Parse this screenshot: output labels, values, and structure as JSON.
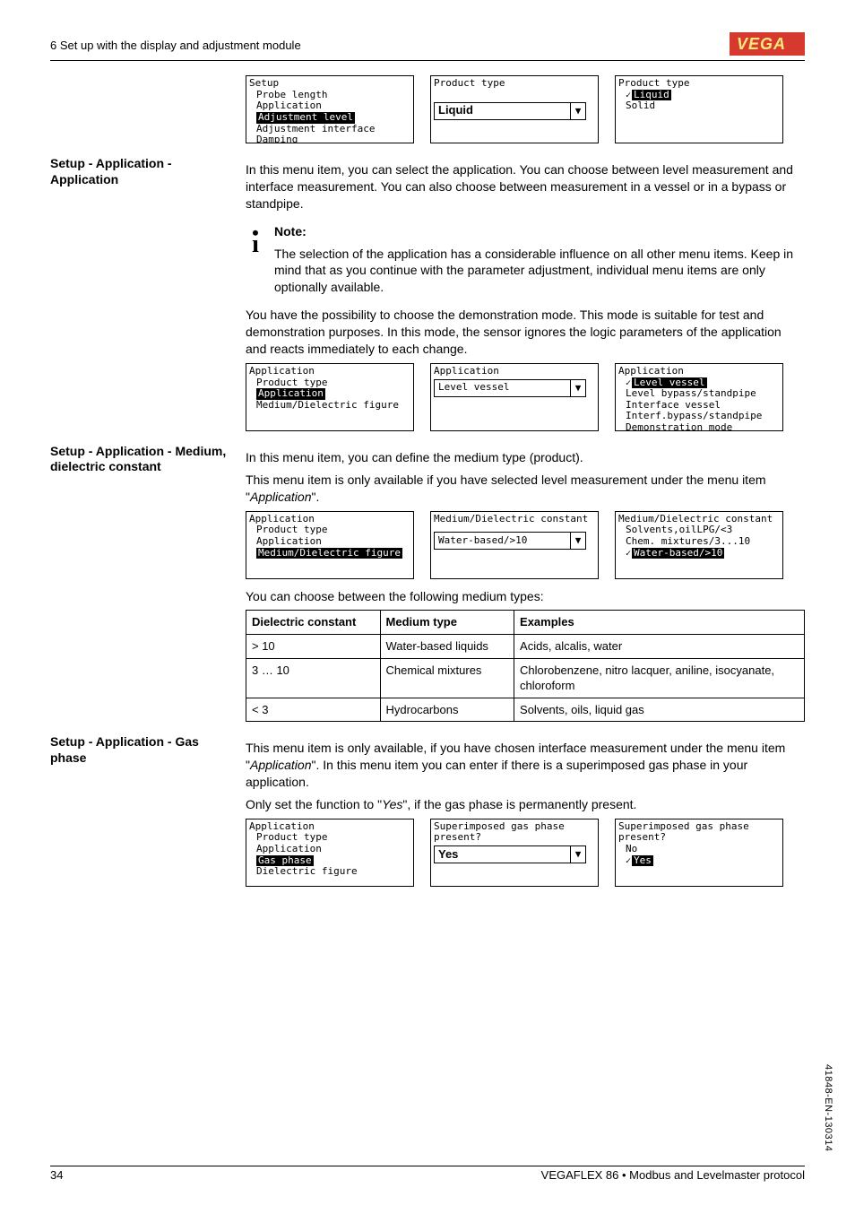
{
  "header": {
    "left": "6 Set up with the display and adjustment module",
    "logo_text": "VEGA"
  },
  "lcd_set1": {
    "a": {
      "title": "Setup",
      "items": [
        "Probe length",
        "Application"
      ],
      "selected": "Adjustment level",
      "items_after": [
        "Adjustment interface",
        "Damping"
      ]
    },
    "b": {
      "title": "Product type",
      "select_value": "Liquid"
    },
    "c": {
      "title": "Product type",
      "selected": "Liquid",
      "item2": "Solid"
    }
  },
  "sec1": {
    "heading": "Setup - Application - Application",
    "p1": "In this menu item, you can select the application. You can choose between level measurement and interface measurement. You can also choose between measurement in a vessel or in a bypass or standpipe."
  },
  "note": {
    "heading": "Note:",
    "p1": "The selection of the application has a considerable influence on all other menu items. Keep in mind that as you continue with the parameter adjustment, individual menu items are only optionally available.",
    "p2": "You have the possibility to choose the demonstration mode. This mode is suitable for test and demonstration purposes. In this mode, the sensor ignores the logic parameters of the application and reacts immediately to each change."
  },
  "lcd_set2": {
    "a": {
      "title": "Application",
      "items_before": [
        "Product type"
      ],
      "selected": "Application",
      "items_after": [
        "Medium/Dielectric figure"
      ]
    },
    "b": {
      "title": "Application",
      "select_value": "Level vessel"
    },
    "c": {
      "title": "Application",
      "selected": "Level vessel",
      "items_after": [
        "Level bypass/standpipe",
        "Interface vessel",
        "Interf.bypass/standpipe",
        "Demonstration mode"
      ]
    }
  },
  "sec2": {
    "heading": "Setup - Application - Medium, dielectric constant",
    "p1": "In this menu item, you can define the medium type (product).",
    "p2a": "This menu item is only available if you have selected level measurement under the menu item \"",
    "p2_italic": "Application",
    "p2b": "\"."
  },
  "lcd_set3": {
    "a": {
      "title": "Application",
      "items_before": [
        "Product type",
        "Application"
      ],
      "selected": "Medium/Dielectric figure"
    },
    "b": {
      "title": "Medium/Dielectric constant",
      "select_value": "Water-based/>10"
    },
    "c": {
      "title": "Medium/Dielectric constant",
      "items_before": [
        "Solvents,oilLPG/<3",
        "Chem. mixtures/3...10"
      ],
      "selected": "Water-based/>10"
    }
  },
  "medium_intro": "You can choose between the following medium types:",
  "medium_table": {
    "h1": "Dielectric constant",
    "h2": "Medium type",
    "h3": "Examples",
    "rows": [
      {
        "c1": "> 10",
        "c2": "Water-based liquids",
        "c3": "Acids, alcalis, water"
      },
      {
        "c1": "3 … 10",
        "c2": "Chemical mixtures",
        "c3": "Chlorobenzene, nitro lacquer, aniline, isocyanate, chloroform"
      },
      {
        "c1": "< 3",
        "c2": "Hydrocarbons",
        "c3": "Solvents, oils, liquid gas"
      }
    ]
  },
  "sec3": {
    "heading": "Setup - Application - Gas phase",
    "p1a": "This menu item is only available, if you have chosen interface measurement under the menu item \"",
    "p1_italic": "Application",
    "p1b": "\". In this menu item you can enter if there is a superimposed gas phase in your application.",
    "p2a": "Only set the function to \"",
    "p2_italic": "Yes",
    "p2b": "\", if the gas phase is permanently present."
  },
  "lcd_set4": {
    "a": {
      "title": "Application",
      "items_before": [
        "Product type",
        "Application"
      ],
      "selected": "Gas phase",
      "items_after": [
        "Dielectric figure"
      ]
    },
    "b": {
      "title": "Superimposed gas phase",
      "subtitle": "present?",
      "select_value": "Yes"
    },
    "c": {
      "title": "Superimposed gas phase",
      "subtitle": "present?",
      "items_before": [
        "No"
      ],
      "selected": "Yes"
    }
  },
  "footer": {
    "page": "34",
    "right": "VEGAFLEX 86 • Modbus and Levelmaster protocol"
  },
  "side": "41848-EN-130314"
}
